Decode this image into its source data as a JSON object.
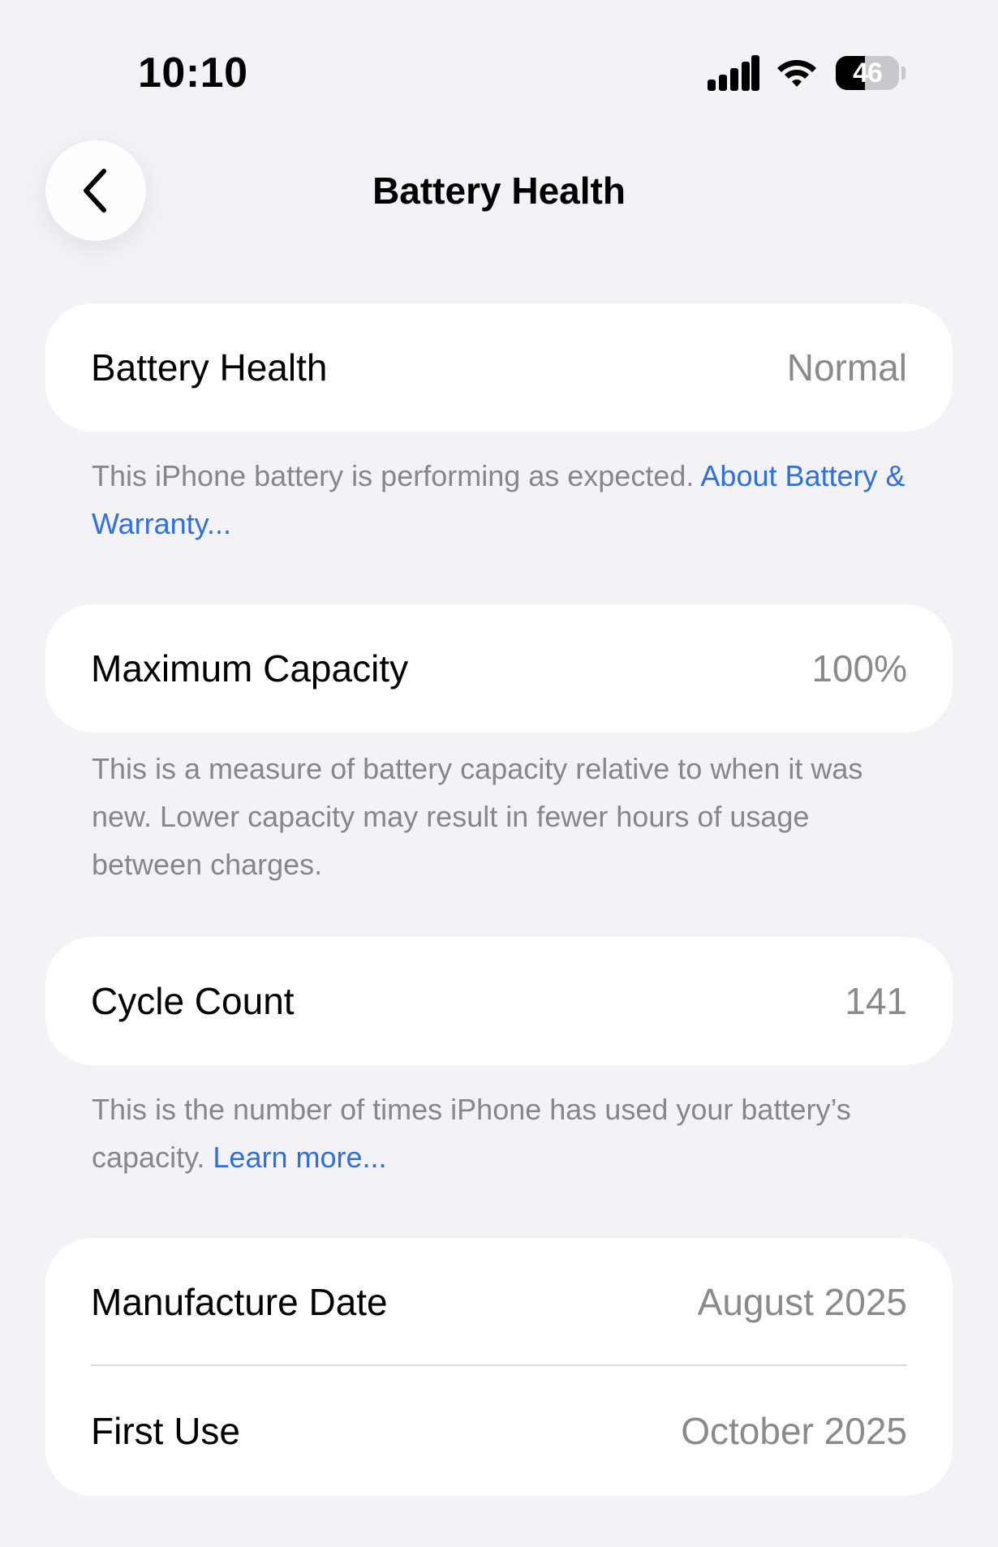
{
  "status_bar": {
    "time": "10:10",
    "battery_percent": 46,
    "battery_label": "46",
    "signal_icon": "cellular-signal-icon",
    "wifi_icon": "wifi-icon",
    "battery_icon": "battery-icon"
  },
  "nav": {
    "back_icon": "chevron-left-icon",
    "title": "Battery Health"
  },
  "sections": {
    "health": {
      "label": "Battery Health",
      "value": "Normal",
      "footnote_text": "This iPhone battery is performing as expected. ",
      "footnote_link": "About Battery & Warranty..."
    },
    "capacity": {
      "label": "Maximum Capacity",
      "value": "100%",
      "footnote_text": "This is a measure of battery capacity relative to when it was new. Lower capacity may result in fewer hours of usage between charges."
    },
    "cycles": {
      "label": "Cycle Count",
      "value": "141",
      "footnote_text": "This is the number of times iPhone has used your battery’s capacity. ",
      "footnote_link": "Learn more..."
    },
    "dates": {
      "manufacture_label": "Manufacture Date",
      "manufacture_value": "August 2025",
      "first_use_label": "First Use",
      "first_use_value": "October 2025"
    }
  },
  "colors": {
    "background": "#f2f2f7",
    "card": "#ffffff",
    "link": "#2f6fe0",
    "secondary_text": "#8a8a8e"
  }
}
